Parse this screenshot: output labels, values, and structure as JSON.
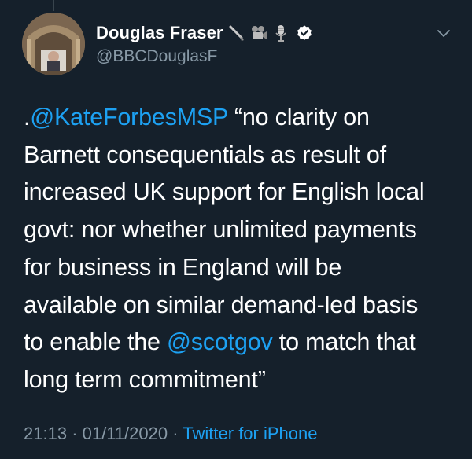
{
  "tweet": {
    "display_name": "Douglas Fraser",
    "handle": "@BBCDouglasF",
    "name_emoji": [
      "pen-icon",
      "film-camera-icon",
      "microphone-icon"
    ],
    "verified": true,
    "text_lines": [
      [
        {
          "t": ".",
          "k": "text"
        },
        {
          "t": "@KateForbesMSP",
          "k": "mention"
        },
        {
          "t": " “no clarity on",
          "k": "text"
        }
      ],
      [
        {
          "t": "Barnett consequentials as result of",
          "k": "text"
        }
      ],
      [
        {
          "t": "increased UK support for English local",
          "k": "text"
        }
      ],
      [
        {
          "t": "govt: nor whether unlimited payments",
          "k": "text"
        }
      ],
      [
        {
          "t": "for business in England will be",
          "k": "text"
        }
      ],
      [
        {
          "t": "available on similar demand-led basis",
          "k": "text"
        }
      ],
      [
        {
          "t": "to enable the ",
          "k": "text"
        },
        {
          "t": "@scotgov",
          "k": "mention"
        },
        {
          "t": " to match that",
          "k": "text"
        }
      ],
      [
        {
          "t": "long term commitment”",
          "k": "text"
        }
      ]
    ],
    "time": "21:13",
    "date": "01/11/2020",
    "separator": "·",
    "source": "Twitter for iPhone"
  },
  "colors": {
    "background": "#15202b",
    "text": "#ffffff",
    "secondary": "#8899a6",
    "link": "#1da1f2"
  }
}
